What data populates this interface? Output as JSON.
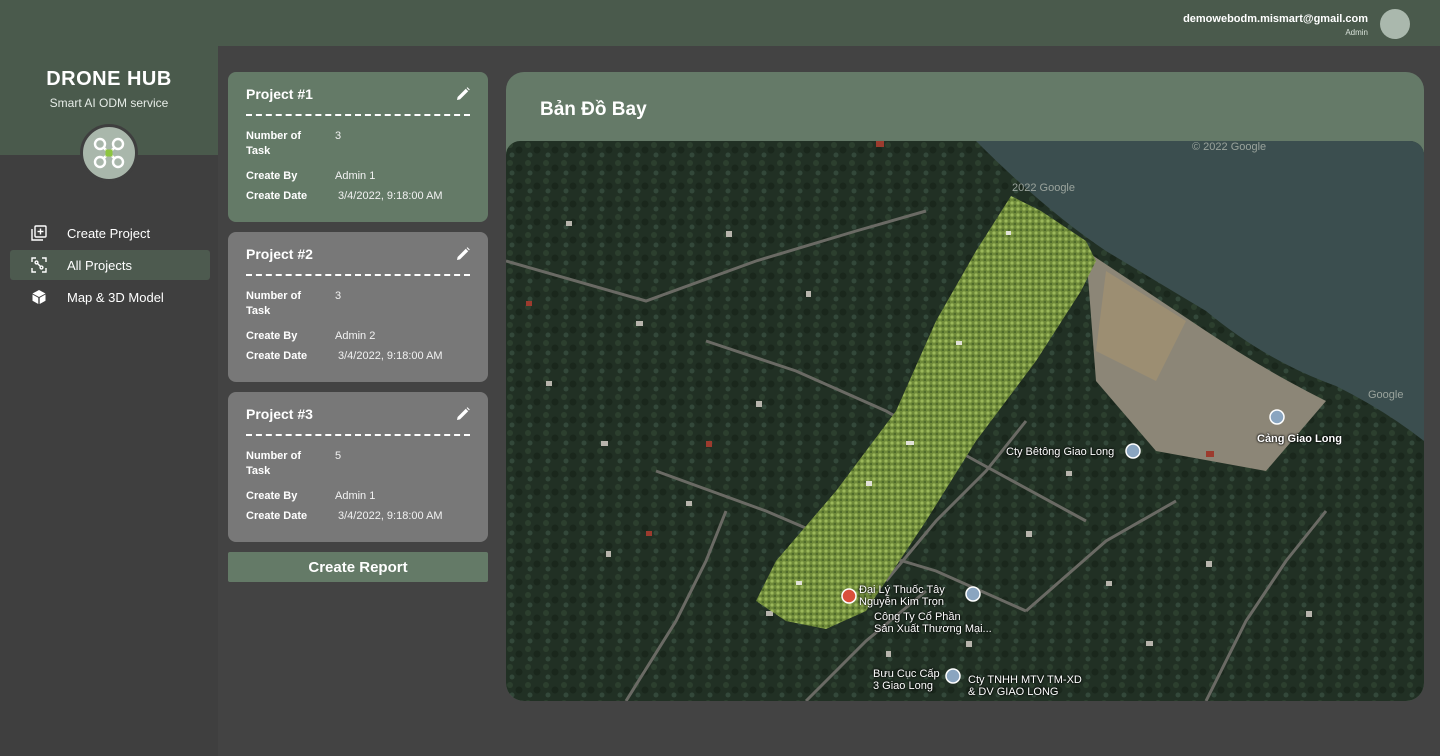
{
  "header": {
    "user_email": "demowebodm.mismart@gmail.com",
    "user_role": "Admin"
  },
  "brand": {
    "title": "DRONE HUB",
    "subtitle": "Smart AI ODM service"
  },
  "nav": {
    "items": [
      {
        "label": "Create Project",
        "icon": "add-box-icon",
        "active": false
      },
      {
        "label": "All Projects",
        "icon": "project-frame-icon",
        "active": true
      },
      {
        "label": "Map & 3D Model",
        "icon": "cube-icon",
        "active": false
      }
    ]
  },
  "projects": [
    {
      "title": "Project #1",
      "tasks_label": "Number of Task",
      "tasks_label_1": "Number of",
      "tasks_label_2": "Task",
      "tasks": "3",
      "created_by_label": "Create By",
      "created_by": "Admin 1",
      "create_date_label": "Create Date",
      "create_date": "3/4/2022, 9:18:00 AM"
    },
    {
      "title": "Project #2",
      "tasks_label_1": "Number of",
      "tasks_label_2": "Task",
      "tasks": "3",
      "created_by_label": "Create By",
      "created_by": "Admin 2",
      "create_date_label": "Create Date",
      "create_date": "3/4/2022, 9:18:00 AM"
    },
    {
      "title": "Project #3",
      "tasks_label_1": "Number of",
      "tasks_label_2": "Task",
      "tasks": "5",
      "created_by_label": "Create By",
      "created_by": "Admin 1",
      "create_date_label": "Create Date",
      "create_date": "3/4/2022, 9:18:00 AM"
    }
  ],
  "actions": {
    "create_report": "Create Report"
  },
  "map": {
    "title": "Bản Đồ Bay",
    "labels": {
      "port": "Cảng Giao Long",
      "betong": "Cty Bêtông Giao Long",
      "pharmacy_1": "Đại Lý Thuốc Tây",
      "pharmacy_2": "Nguyễn Kim Trọn",
      "company_1": "Công Ty Cổ Phần",
      "company_2": "Sản Xuất Thương Mại...",
      "post_1": "Bưu Cục Cấp",
      "post_2": "3 Giao Long",
      "tnhh_1": "Cty TNHH MTV TM-XD",
      "tnhh_2": "& DV GIAO LONG",
      "copyright": "© 2022 Google",
      "copyright_2": "2022 Google",
      "google": "Google"
    }
  },
  "colors": {
    "header_bg": "#4a5a4c",
    "card_active": "#647a67",
    "card_inactive": "#787878",
    "page_bg": "#434343"
  }
}
